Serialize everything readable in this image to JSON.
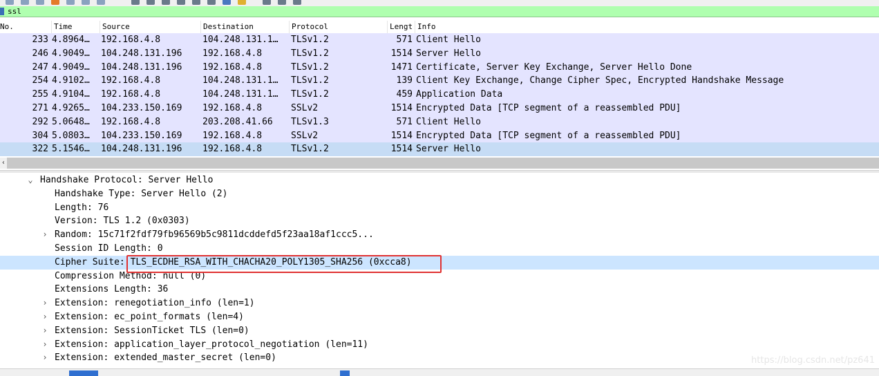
{
  "filter": {
    "value": "ssl"
  },
  "columns": [
    "No.",
    "Time",
    "Source",
    "Destination",
    "Protocol",
    "Lengt",
    "Info"
  ],
  "packets": [
    {
      "no": "233",
      "time": "4.8964…",
      "source": "192.168.4.8",
      "destination": "104.248.131.1…",
      "protocol": "TLSv1.2",
      "length": "571",
      "info": "Client Hello"
    },
    {
      "no": "246",
      "time": "4.9049…",
      "source": "104.248.131.196",
      "destination": "192.168.4.8",
      "protocol": "TLSv1.2",
      "length": "1514",
      "info": "Server Hello"
    },
    {
      "no": "247",
      "time": "4.9049…",
      "source": "104.248.131.196",
      "destination": "192.168.4.8",
      "protocol": "TLSv1.2",
      "length": "1471",
      "info": "Certificate, Server Key Exchange, Server Hello Done"
    },
    {
      "no": "254",
      "time": "4.9102…",
      "source": "192.168.4.8",
      "destination": "104.248.131.1…",
      "protocol": "TLSv1.2",
      "length": "139",
      "info": "Client Key Exchange, Change Cipher Spec, Encrypted Handshake Message"
    },
    {
      "no": "255",
      "time": "4.9104…",
      "source": "192.168.4.8",
      "destination": "104.248.131.1…",
      "protocol": "TLSv1.2",
      "length": "459",
      "info": "Application Data"
    },
    {
      "no": "271",
      "time": "4.9265…",
      "source": "104.233.150.169",
      "destination": "192.168.4.8",
      "protocol": "SSLv2",
      "length": "1514",
      "info": "Encrypted Data [TCP segment of a reassembled PDU]"
    },
    {
      "no": "292",
      "time": "5.0648…",
      "source": "192.168.4.8",
      "destination": "203.208.41.66",
      "protocol": "TLSv1.3",
      "length": "571",
      "info": "Client Hello"
    },
    {
      "no": "304",
      "time": "5.0803…",
      "source": "104.233.150.169",
      "destination": "192.168.4.8",
      "protocol": "SSLv2",
      "length": "1514",
      "info": "Encrypted Data [TCP segment of a reassembled PDU]"
    },
    {
      "no": "322",
      "time": "5.1546…",
      "source": "104.248.131.196",
      "destination": "192.168.4.8",
      "protocol": "TLSv1.2",
      "length": "1514",
      "info": "Server Hello"
    }
  ],
  "selected_packet_index": 8,
  "details": [
    {
      "text": "Handshake Protocol: Server Hello",
      "expander": "open"
    },
    {
      "text": "Handshake Type: Server Hello (2)",
      "expander": "none"
    },
    {
      "text": "Length: 76",
      "expander": "none"
    },
    {
      "text": "Version: TLS 1.2 (0x0303)",
      "expander": "none"
    },
    {
      "text": "Random: 15c71f2fdf79fb96569b5c9811dcddefd5f23aa18af1ccc5...",
      "expander": "closed"
    },
    {
      "text": "Session ID Length: 0",
      "expander": "none"
    },
    {
      "text": "Cipher Suite: TLS_ECDHE_RSA_WITH_CHACHA20_POLY1305_SHA256 (0xcca8)",
      "expander": "none"
    },
    {
      "text": "Compression Method: null (0)",
      "expander": "none"
    },
    {
      "text": "Extensions Length: 36",
      "expander": "none"
    },
    {
      "text": "Extension: renegotiation_info (len=1)",
      "expander": "closed"
    },
    {
      "text": "Extension: ec_point_formats (len=4)",
      "expander": "closed"
    },
    {
      "text": "Extension: SessionTicket TLS (len=0)",
      "expander": "closed"
    },
    {
      "text": "Extension: application_layer_protocol_negotiation (len=11)",
      "expander": "closed"
    },
    {
      "text": "Extension: extended_master_secret (len=0)",
      "expander": "closed"
    }
  ],
  "selected_detail_index": 6,
  "watermark": "https://blog.csdn.net/pz641",
  "icons": {
    "filter": "bookmark-icon",
    "scroll_left": "chevron-left-icon",
    "expand_open": "chevron-down-icon",
    "expand_closed": "chevron-right-icon"
  }
}
